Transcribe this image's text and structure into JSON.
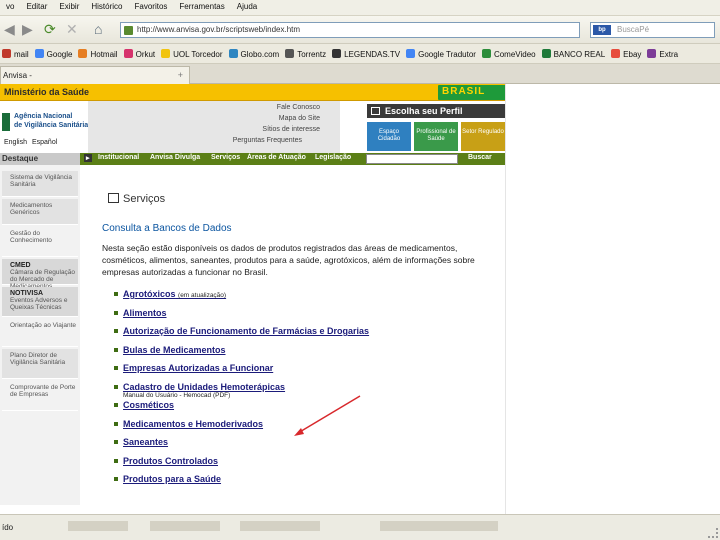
{
  "browser": {
    "menu": [
      "vo",
      "Editar",
      "Exibir",
      "Histórico",
      "Favoritos",
      "Ferramentas",
      "Ajuda"
    ],
    "url": "http://www.anvisa.gov.br/scriptsweb/index.htm",
    "search_placeholder": "BuscaPé",
    "search_engine_badge": "bp",
    "bookmarks": [
      {
        "label": "mail",
        "color": "#c0392b"
      },
      {
        "label": "Google",
        "color": "#4285f4"
      },
      {
        "label": "Hotmail",
        "color": "#e67e22"
      },
      {
        "label": "Orkut",
        "color": "#d6336c"
      },
      {
        "label": "UOL Torcedor",
        "color": "#f1c40f"
      },
      {
        "label": "Globo.com",
        "color": "#2e86c1"
      },
      {
        "label": "Torrentz",
        "color": "#555555"
      },
      {
        "label": "LEGENDAS.TV",
        "color": "#333333"
      },
      {
        "label": "Google Tradutor",
        "color": "#4285f4"
      },
      {
        "label": "ComeVideo",
        "color": "#2c8d3a"
      },
      {
        "label": "BANCO REAL",
        "color": "#1f7a3a"
      },
      {
        "label": "Ebay",
        "color": "#e74c3c"
      },
      {
        "label": "Extra",
        "color": "#7d3c98"
      }
    ],
    "tab_title": "Anvisa -",
    "status": "ído"
  },
  "site": {
    "ministry": "Ministério da Saúde",
    "flag_text": "BRASIL",
    "agency_lines": [
      "Agência Nacional",
      "de Vigilância Sanitária"
    ],
    "languages": [
      "English",
      "Español"
    ],
    "quick_links": [
      "Fale Conosco",
      "Mapa do Site",
      "Sítios de interesse",
      "Perguntas Frequentes"
    ],
    "perfil_title": "Escolha seu Perfil",
    "perfil_cards": [
      {
        "label": "Espaço Cidadão",
        "color": "#2f80c0"
      },
      {
        "label": "Profissional de Saúde",
        "color": "#3a9a4a"
      },
      {
        "label": "Setor Regulado",
        "color": "#c8a016"
      }
    ],
    "destaque": "Destaque",
    "nav": [
      "Institucional",
      "Anvisa Divulga",
      "Serviços",
      "Áreas de Atuação",
      "Legislação"
    ],
    "search_button": "Buscar",
    "sidebar": [
      {
        "title": "Sistema de Vigilância Sanitária",
        "sub": ""
      },
      {
        "title": "Medicamentos Genéricos",
        "sub": ""
      },
      {
        "title": "Gestão do Conhecimento",
        "sub": ""
      },
      {
        "title": "CMED",
        "sub": "Câmara de Regulação do Mercado de Medicamentos"
      },
      {
        "title": "NOTIVISA",
        "sub": "Eventos Adversos e Queixas Técnicas"
      },
      {
        "title": "Orientação ao Viajante",
        "sub": ""
      },
      {
        "title": "Plano Diretor de Vigilância Sanitária",
        "sub": ""
      },
      {
        "title": "Comprovante de Porte de Empresas",
        "sub": ""
      }
    ],
    "section_title": "Serviços",
    "consulta_title": "Consulta a Bancos de Dados",
    "intro": "Nesta seção estão disponíveis os dados de produtos registrados das áreas de medicamentos, cosméticos, alimentos, saneantes, produtos para a saúde, agrotóxicos, além de informações sobre empresas autorizadas a funcionar no Brasil.",
    "links": [
      {
        "label": "Agrotóxicos",
        "note": "(em atualização)",
        "sub": ""
      },
      {
        "label": "Alimentos",
        "note": "",
        "sub": ""
      },
      {
        "label": "Autorização de Funcionamento de Farmácias e Drogarias",
        "note": "",
        "sub": ""
      },
      {
        "label": "Bulas de Medicamentos",
        "note": "",
        "sub": ""
      },
      {
        "label": "Empresas Autorizadas a Funcionar",
        "note": "",
        "sub": ""
      },
      {
        "label": "Cadastro de Unidades Hemoterápicas",
        "note": "",
        "sub": "Manual do Usuário - Hemocad (PDF)"
      },
      {
        "label": "Cosméticos",
        "note": "",
        "sub": ""
      },
      {
        "label": "Medicamentos e Hemoderivados",
        "note": "",
        "sub": ""
      },
      {
        "label": "Saneantes",
        "note": "",
        "sub": ""
      },
      {
        "label": "Produtos Controlados",
        "note": "",
        "sub": ""
      },
      {
        "label": "Produtos para a Saúde",
        "note": "",
        "sub": ""
      }
    ]
  },
  "annotation": {
    "arrow_color": "#d8282c"
  }
}
